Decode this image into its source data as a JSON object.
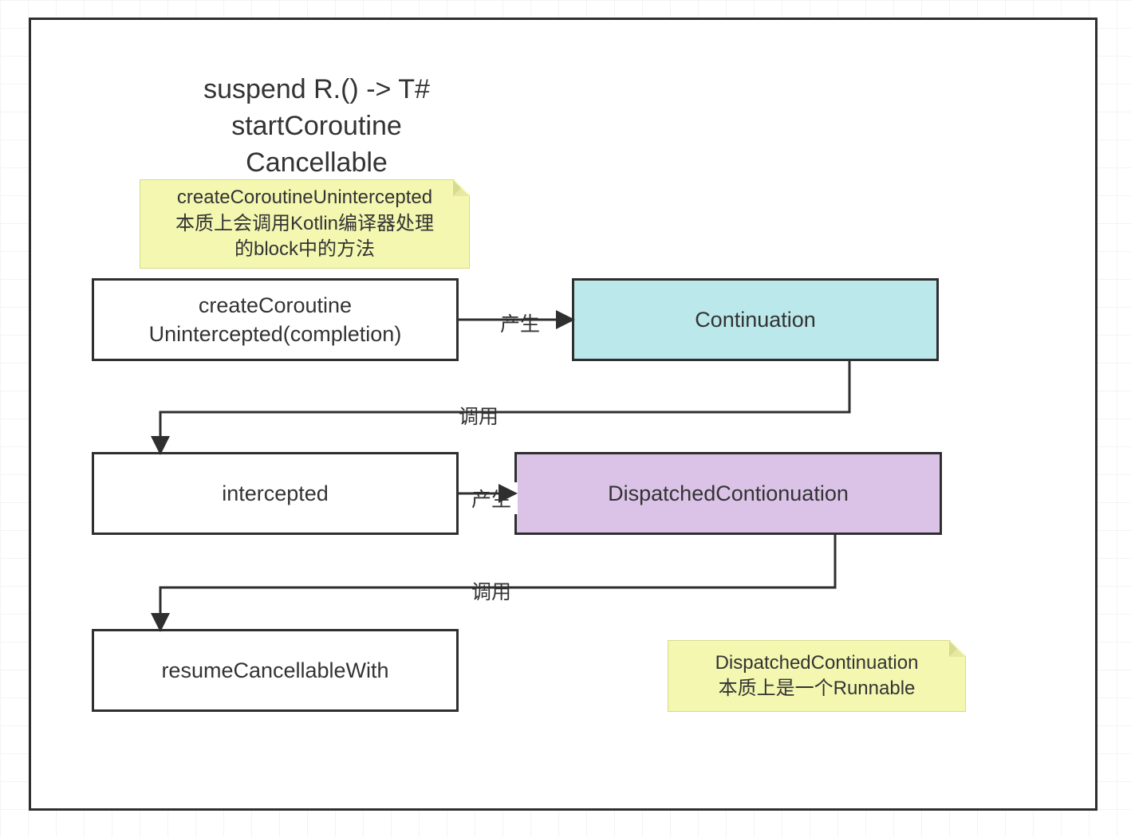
{
  "title": {
    "line1": "suspend R.() -> T#",
    "line2": "startCoroutine",
    "line3": "Cancellable"
  },
  "notes": {
    "top": {
      "line1": "createCoroutineUnintercepted",
      "line2": "本质上会调用Kotlin编译器处理",
      "line3": "的block中的方法"
    },
    "bottom": {
      "line1": "DispatchedContinuation",
      "line2": "本质上是一个Runnable"
    }
  },
  "boxes": {
    "create": {
      "line1": "createCoroutine",
      "line2": "Unintercepted(completion)"
    },
    "continuation": {
      "label": "Continuation"
    },
    "intercepted": {
      "label": "intercepted"
    },
    "dispatched": {
      "label": "DispatchedContionuation"
    },
    "resume": {
      "label": "resumeCancellableWith"
    }
  },
  "edges": {
    "produce": "产生",
    "call": "调用"
  }
}
